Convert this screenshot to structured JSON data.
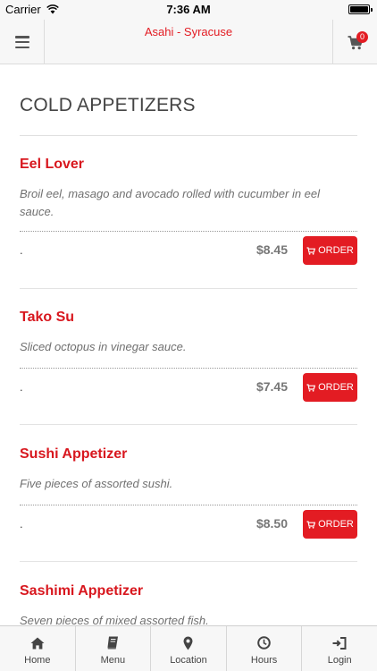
{
  "status_bar": {
    "carrier": "Carrier",
    "time": "7:36 AM"
  },
  "header": {
    "title": "Asahi - Syracuse",
    "cart_count": "0"
  },
  "section": {
    "title": "COLD APPETIZERS"
  },
  "items": [
    {
      "name": "Eel Lover",
      "description": "Broil eel, masago and avocado rolled with cucumber in eel sauce.",
      "dot": ".",
      "price": "$8.45",
      "order_label": "ORDER"
    },
    {
      "name": "Tako Su",
      "description": "Sliced octopus in vinegar sauce.",
      "dot": ".",
      "price": "$7.45",
      "order_label": "ORDER"
    },
    {
      "name": "Sushi Appetizer",
      "description": "Five pieces of assorted sushi.",
      "dot": ".",
      "price": "$8.50",
      "order_label": "ORDER"
    },
    {
      "name": "Sashimi Appetizer",
      "description": "Seven pieces of mixed assorted fish."
    }
  ],
  "tabs": [
    {
      "label": "Home",
      "icon": "home-icon"
    },
    {
      "label": "Menu",
      "icon": "book-icon"
    },
    {
      "label": "Location",
      "icon": "map-marker-icon"
    },
    {
      "label": "Hours",
      "icon": "clock-icon"
    },
    {
      "label": "Login",
      "icon": "sign-in-icon"
    }
  ],
  "colors": {
    "accent": "#e31c23",
    "item_title": "#d8171e",
    "price": "#777777"
  }
}
